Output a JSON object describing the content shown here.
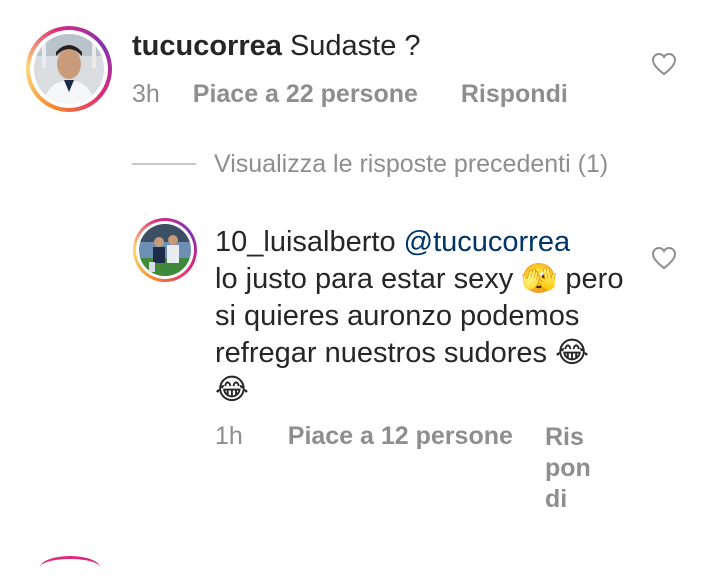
{
  "comment": {
    "username": "tucucorrea",
    "text": "Sudaste ?",
    "time": "3h",
    "likes": "Piace a 22 persone",
    "reply": "Rispondi"
  },
  "view_previous": "Visualizza le risposte precedenti (1)",
  "reply_comment": {
    "username": "10_luisalberto",
    "mention": "@tucucorrea",
    "line1": "lo justo para estar sexy 🫣 pero",
    "line2": "si quieres auronzo podemos",
    "line3": "refregar nuestros sudores 😂",
    "line4": "😂",
    "time": "1h",
    "likes": "Piace a 12 persone",
    "reply_line1": "Ris",
    "reply_line2": "pon",
    "reply_line3": "di"
  },
  "icons": {
    "heart": "heart-outline-icon"
  },
  "colors": {
    "mention": "#003569",
    "meta": "#8e8e8e"
  }
}
